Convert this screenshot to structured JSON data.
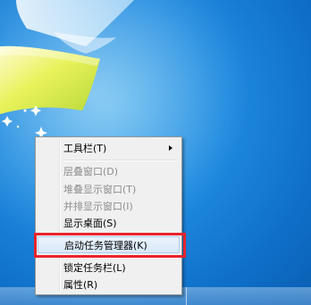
{
  "desktop": {
    "accent_color": "#1f8be0"
  },
  "context_menu": {
    "items": [
      {
        "label": "工具栏(T)",
        "enabled": true,
        "has_submenu": true
      },
      {
        "label": "层叠窗口(D)",
        "enabled": false
      },
      {
        "label": "堆叠显示窗口(T)",
        "enabled": false
      },
      {
        "label": "并排显示窗口(I)",
        "enabled": false
      },
      {
        "label": "显示桌面(S)",
        "enabled": true
      },
      {
        "label": "启动任务管理器(K)",
        "enabled": true,
        "highlighted": true
      },
      {
        "label": "锁定任务栏(L)",
        "enabled": true
      },
      {
        "label": "属性(R)",
        "enabled": true
      }
    ],
    "highlight_color": "#e8242c"
  }
}
